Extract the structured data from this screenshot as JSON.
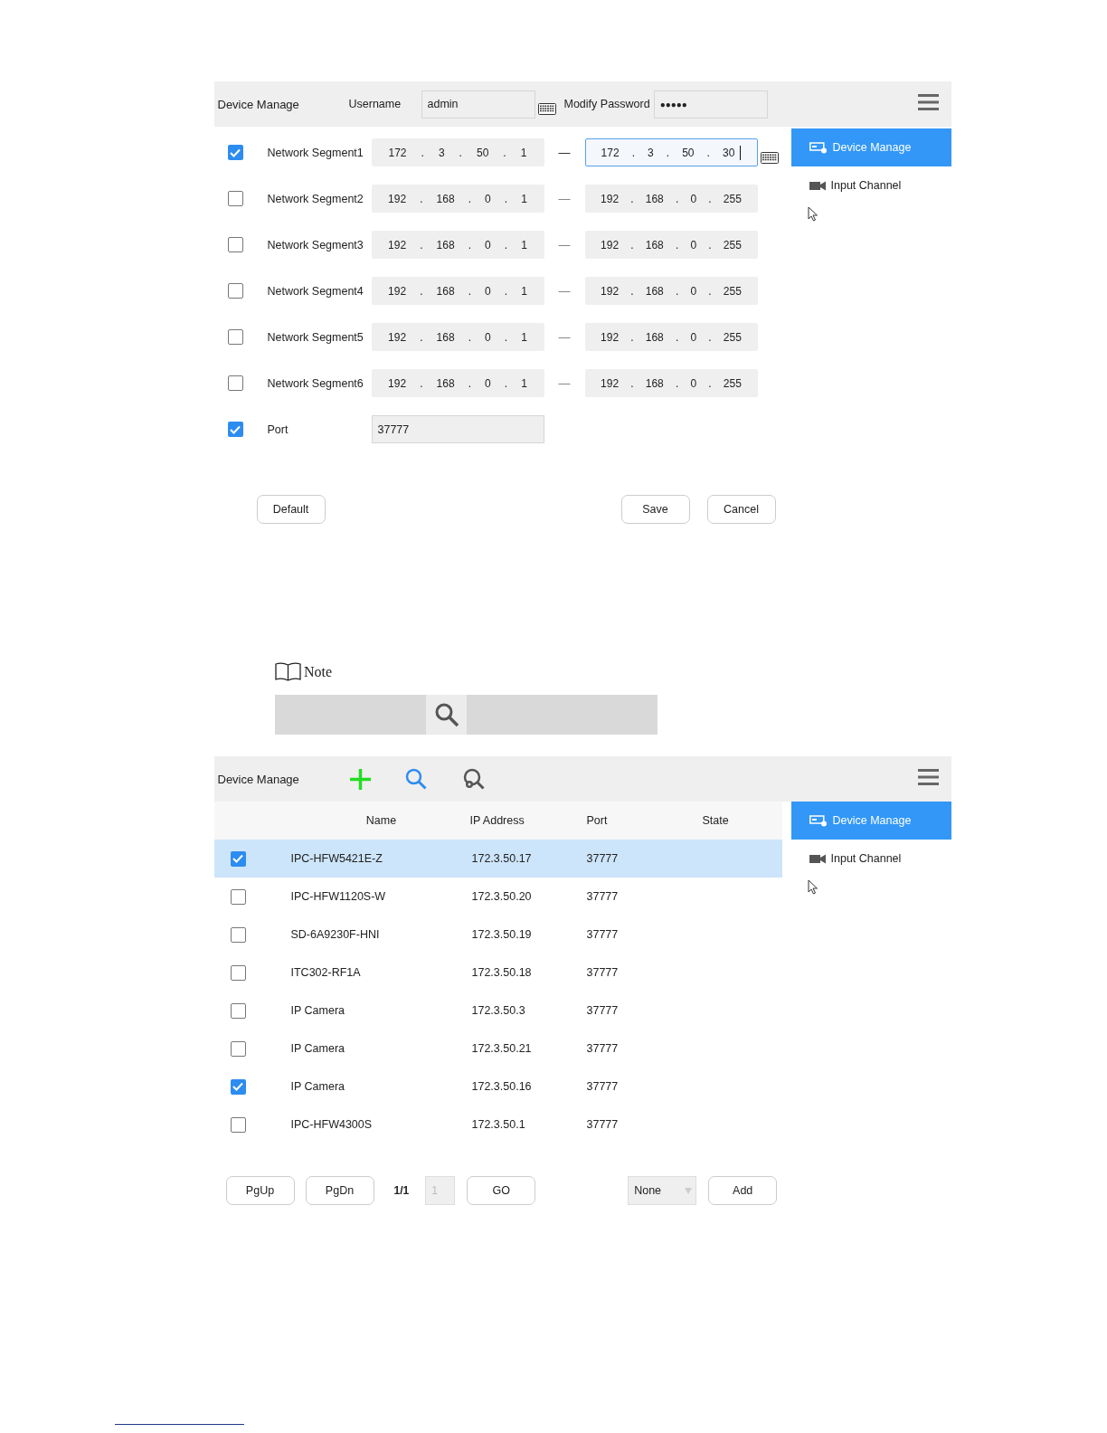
{
  "segment_screen": {
    "title": "Device Manage",
    "username_label": "Username",
    "username": "admin",
    "password_label": "Modify Password",
    "password": "●●●●●",
    "separator": ".",
    "dash": "—",
    "rows": [
      {
        "label": "Network Segment1",
        "checked": true,
        "start": [
          "172",
          "3",
          "50",
          "1"
        ],
        "end": [
          "172",
          "3",
          "50",
          "30"
        ],
        "focused": true
      },
      {
        "label": "Network Segment2",
        "checked": false,
        "start": [
          "192",
          "168",
          "0",
          "1"
        ],
        "end": [
          "192",
          "168",
          "0",
          "255"
        ],
        "focused": false
      },
      {
        "label": "Network Segment3",
        "checked": false,
        "start": [
          "192",
          "168",
          "0",
          "1"
        ],
        "end": [
          "192",
          "168",
          "0",
          "255"
        ],
        "focused": false
      },
      {
        "label": "Network Segment4",
        "checked": false,
        "start": [
          "192",
          "168",
          "0",
          "1"
        ],
        "end": [
          "192",
          "168",
          "0",
          "255"
        ],
        "focused": false
      },
      {
        "label": "Network Segment5",
        "checked": false,
        "start": [
          "192",
          "168",
          "0",
          "1"
        ],
        "end": [
          "192",
          "168",
          "0",
          "255"
        ],
        "focused": false
      },
      {
        "label": "Network Segment6",
        "checked": false,
        "start": [
          "192",
          "168",
          "0",
          "1"
        ],
        "end": [
          "192",
          "168",
          "0",
          "255"
        ],
        "focused": false
      }
    ],
    "port": {
      "label": "Port",
      "checked": true,
      "value": "37777"
    },
    "buttons": [
      "Default",
      "Save",
      "Cancel"
    ],
    "sidebar": [
      {
        "label": "Device Manage",
        "selected": true,
        "kind": "device"
      },
      {
        "label": "Input Channel",
        "selected": false,
        "kind": "camera"
      }
    ]
  },
  "note": {
    "label": "Note"
  },
  "device_screen": {
    "title": "Device Manage",
    "columns": [
      "Name",
      "IP Address",
      "Port",
      "State"
    ],
    "rows": [
      {
        "name": "IPC-HFW5421E-Z",
        "ip": "172.3.50.17",
        "port": "37777",
        "checked": true,
        "selected": true
      },
      {
        "name": "IPC-HFW1120S-W",
        "ip": "172.3.50.20",
        "port": "37777",
        "checked": false,
        "selected": false
      },
      {
        "name": "SD-6A9230F-HNI",
        "ip": "172.3.50.19",
        "port": "37777",
        "checked": false,
        "selected": false
      },
      {
        "name": "ITC302-RF1A",
        "ip": "172.3.50.18",
        "port": "37777",
        "checked": false,
        "selected": false
      },
      {
        "name": "IP Camera",
        "ip": "172.3.50.3",
        "port": "37777",
        "checked": false,
        "selected": false
      },
      {
        "name": "IP Camera",
        "ip": "172.3.50.21",
        "port": "37777",
        "checked": false,
        "selected": false
      },
      {
        "name": "IP Camera",
        "ip": "172.3.50.16",
        "port": "37777",
        "checked": true,
        "selected": false
      },
      {
        "name": "IPC-HFW4300S",
        "ip": "172.3.50.1",
        "port": "37777",
        "checked": false,
        "selected": false
      }
    ],
    "pagination": {
      "prev": "PgUp",
      "next": "PgDn",
      "page": "1/1",
      "page_input": "1",
      "go": "GO",
      "filter": "None",
      "add": "Add"
    },
    "sidebar": [
      {
        "label": "Device Manage",
        "selected": true,
        "kind": "device"
      },
      {
        "label": "Input Channel",
        "selected": false,
        "kind": "camera"
      }
    ]
  }
}
